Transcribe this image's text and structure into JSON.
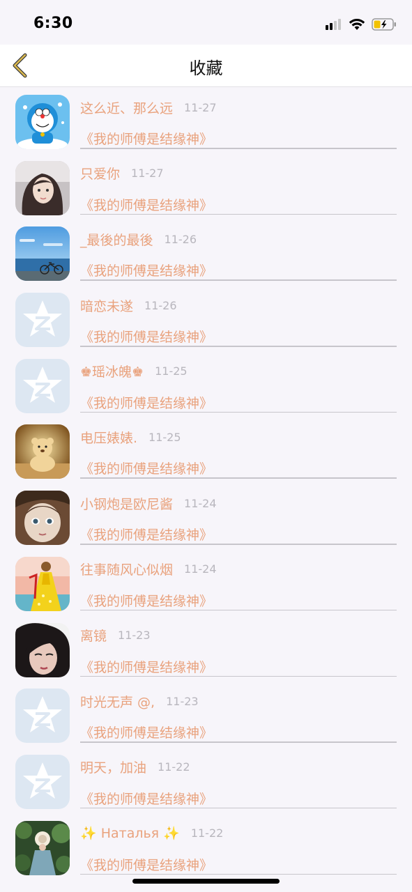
{
  "status_bar": {
    "time": "6:30"
  },
  "header": {
    "title": "收藏"
  },
  "items": [
    {
      "name": "这么近、那么远",
      "date": "11-27",
      "book": "《我的师傅是结缘神》",
      "avatar": "doraemon"
    },
    {
      "name": "只爱你",
      "date": "11-27",
      "book": "《我的师傅是结缘神》",
      "avatar": "girl"
    },
    {
      "name": "_最後的最後",
      "date": "11-26",
      "book": "《我的师傅是结缘神》",
      "avatar": "sea-bicycle"
    },
    {
      "name": "暗恋未遂",
      "date": "11-26",
      "book": "《我的师傅是结缘神》",
      "avatar": "qzone-default"
    },
    {
      "name": "♚瑶冰魄♚",
      "date": "11-25",
      "book": "《我的师傅是结缘神》",
      "avatar": "qzone-default"
    },
    {
      "name": "电压婊婊.",
      "date": "11-25",
      "book": "《我的师傅是结缘神》",
      "avatar": "bear"
    },
    {
      "name": "小钢炮是欧尼酱",
      "date": "11-24",
      "book": "《我的师傅是结缘神》",
      "avatar": "doll"
    },
    {
      "name": "往事随风心似烟",
      "date": "11-24",
      "book": "《我的师傅是结缘神》",
      "avatar": "yellow-dress"
    },
    {
      "name": "离镜",
      "date": "11-23",
      "book": "《我的师傅是结缘神》",
      "avatar": "woman-portrait"
    },
    {
      "name": "时光无声 @,",
      "date": "11-23",
      "book": "《我的师傅是结缘神》",
      "avatar": "qzone-default"
    },
    {
      "name": "明天，加油",
      "date": "11-22",
      "book": "《我的师傅是结缘神》",
      "avatar": "qzone-default"
    },
    {
      "name": "✨ Наталья ✨",
      "date": "11-22",
      "book": "《我的师傅是结缘神》",
      "avatar": "garden-girl"
    }
  ],
  "colors": {
    "accent_text": "#e9a27d",
    "date_text": "#b8b6bd",
    "background": "#f7f5fa",
    "back_arrow": "#c9a54a"
  }
}
